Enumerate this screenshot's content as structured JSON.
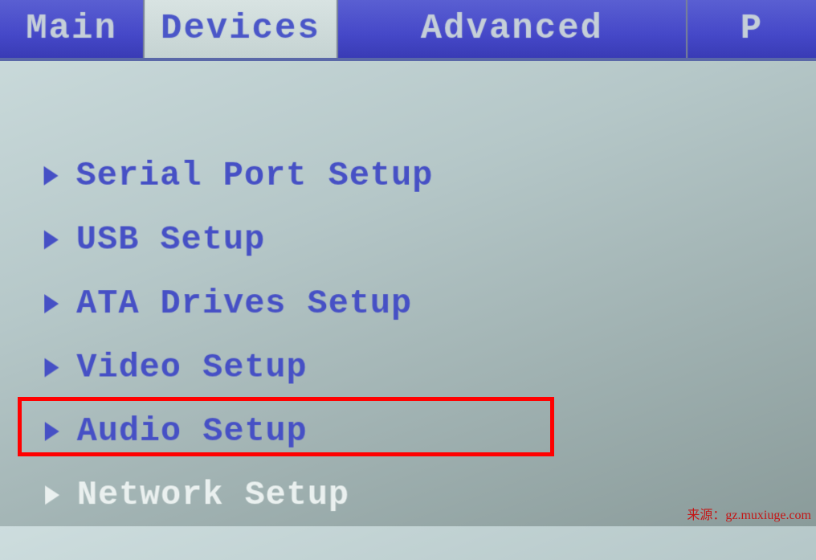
{
  "tabs": {
    "main": "Main",
    "devices": "Devices",
    "advanced": "Advanced",
    "partial": "P"
  },
  "menu": {
    "items": [
      {
        "label": "Serial Port Setup"
      },
      {
        "label": "USB Setup"
      },
      {
        "label": "ATA Drives Setup"
      },
      {
        "label": "Video Setup"
      },
      {
        "label": "Audio Setup"
      },
      {
        "label": "Network Setup"
      }
    ]
  },
  "watermark": "来源：gz.muxiuge.com"
}
